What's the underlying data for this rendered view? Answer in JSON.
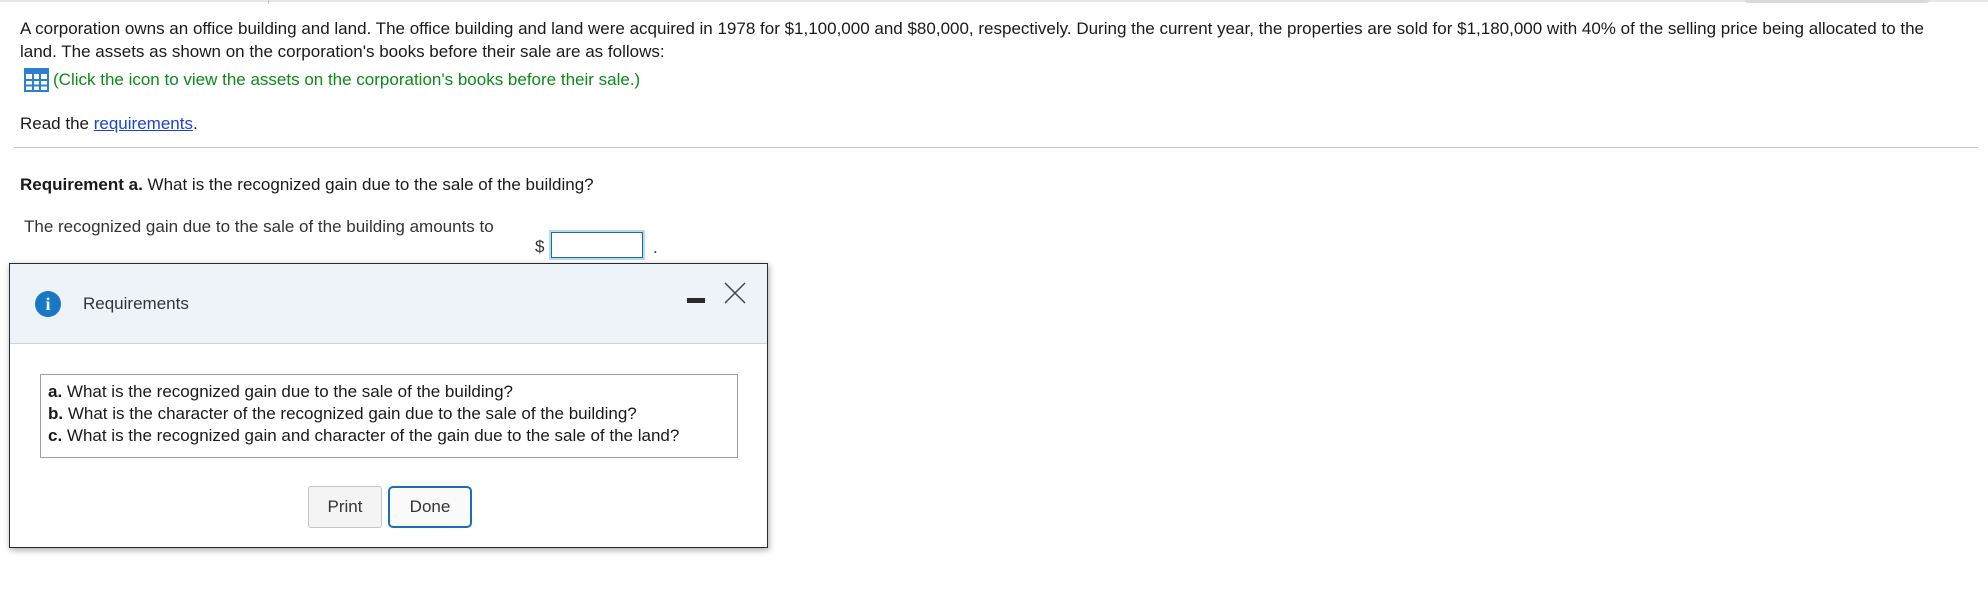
{
  "problem_text": "A corporation owns an office building and land. The office building and land were acquired in 1978 for $1,100,000 and $80,000, respectively. During the current year, the properties are sold for $1,180,000 with 40% of the selling price being allocated to the land. The assets as shown on the corporation's books before their sale are as follows:",
  "assets_link": {
    "icon": "table-icon",
    "text": "(Click the icon to view the assets on the corporation's books before their sale.)",
    "color": "#0c8a17"
  },
  "read_req": {
    "prefix": "Read the ",
    "link": "requirements",
    "suffix": "."
  },
  "requirement_a": {
    "label": "Requirement a.",
    "question": " What is the recognized gain due to the sale of the building?"
  },
  "answer": {
    "label": "The recognized gain due to the sale of the building amounts to",
    "currency": "$",
    "value": "",
    "suffix": "."
  },
  "modal": {
    "icon": "info-icon",
    "title": "Requirements",
    "requirements": [
      {
        "letter": "a.",
        "text": " What is the recognized gain due to the sale of the building?"
      },
      {
        "letter": "b.",
        "text": " What is the character of the recognized gain due to the sale of the building?"
      },
      {
        "letter": "c.",
        "text": " What is the recognized gain and character of the gain due to the sale of the land?"
      }
    ],
    "print_label": "Print",
    "done_label": "Done"
  },
  "colors": {
    "link_blue": "#1a44d6",
    "accent_blue": "#1a6fb8",
    "info_blue": "#1878c6"
  }
}
